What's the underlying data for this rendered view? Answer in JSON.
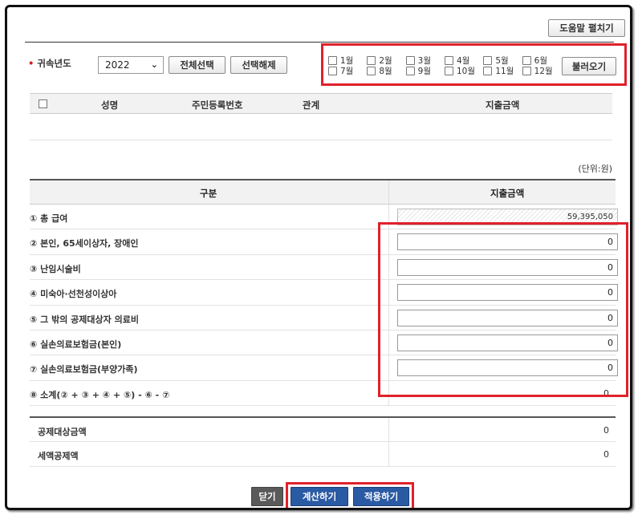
{
  "help_button": "도움말 펼치기",
  "filter": {
    "year_label": "귀속년도",
    "year_value": "2022",
    "select_all": "전체선택",
    "deselect": "선택해제",
    "load": "불러오기",
    "months_row1": [
      "1월",
      "2월",
      "3월",
      "4월",
      "5월",
      "6월"
    ],
    "months_row2": [
      "7월",
      "8월",
      "9월",
      "10월",
      "11월",
      "12월"
    ]
  },
  "dependents_table": {
    "headers": [
      "성명",
      "주민등록번호",
      "관계",
      "지출금액"
    ]
  },
  "unit_label": "(단위:원)",
  "grid": {
    "col_category": "구분",
    "col_amount": "지출금액",
    "rows": [
      {
        "label": "① 총 급여",
        "value": "59,395,050"
      },
      {
        "label": "② 본인, 65세이상자, 장애인",
        "value": "0"
      },
      {
        "label": "③ 난임시술비",
        "value": "0"
      },
      {
        "label": "④ 미숙아·선천성이상아",
        "value": "0"
      },
      {
        "label": "⑤ 그 밖의 공제대상자 의료비",
        "value": "0"
      },
      {
        "label": "⑥ 실손의료보험금(본인)",
        "value": "0"
      },
      {
        "label": "⑦ 실손의료보험금(부양가족)",
        "value": "0"
      },
      {
        "label": "⑧ 소계(② + ③ + ④ + ⑤) - ⑥ - ⑦",
        "value": "0"
      }
    ],
    "summary": [
      {
        "label": "공제대상금액",
        "value": "0"
      },
      {
        "label": "세액공제액",
        "value": "0"
      }
    ]
  },
  "actions": {
    "close": "닫기",
    "calculate": "계산하기",
    "apply": "적용하기"
  }
}
